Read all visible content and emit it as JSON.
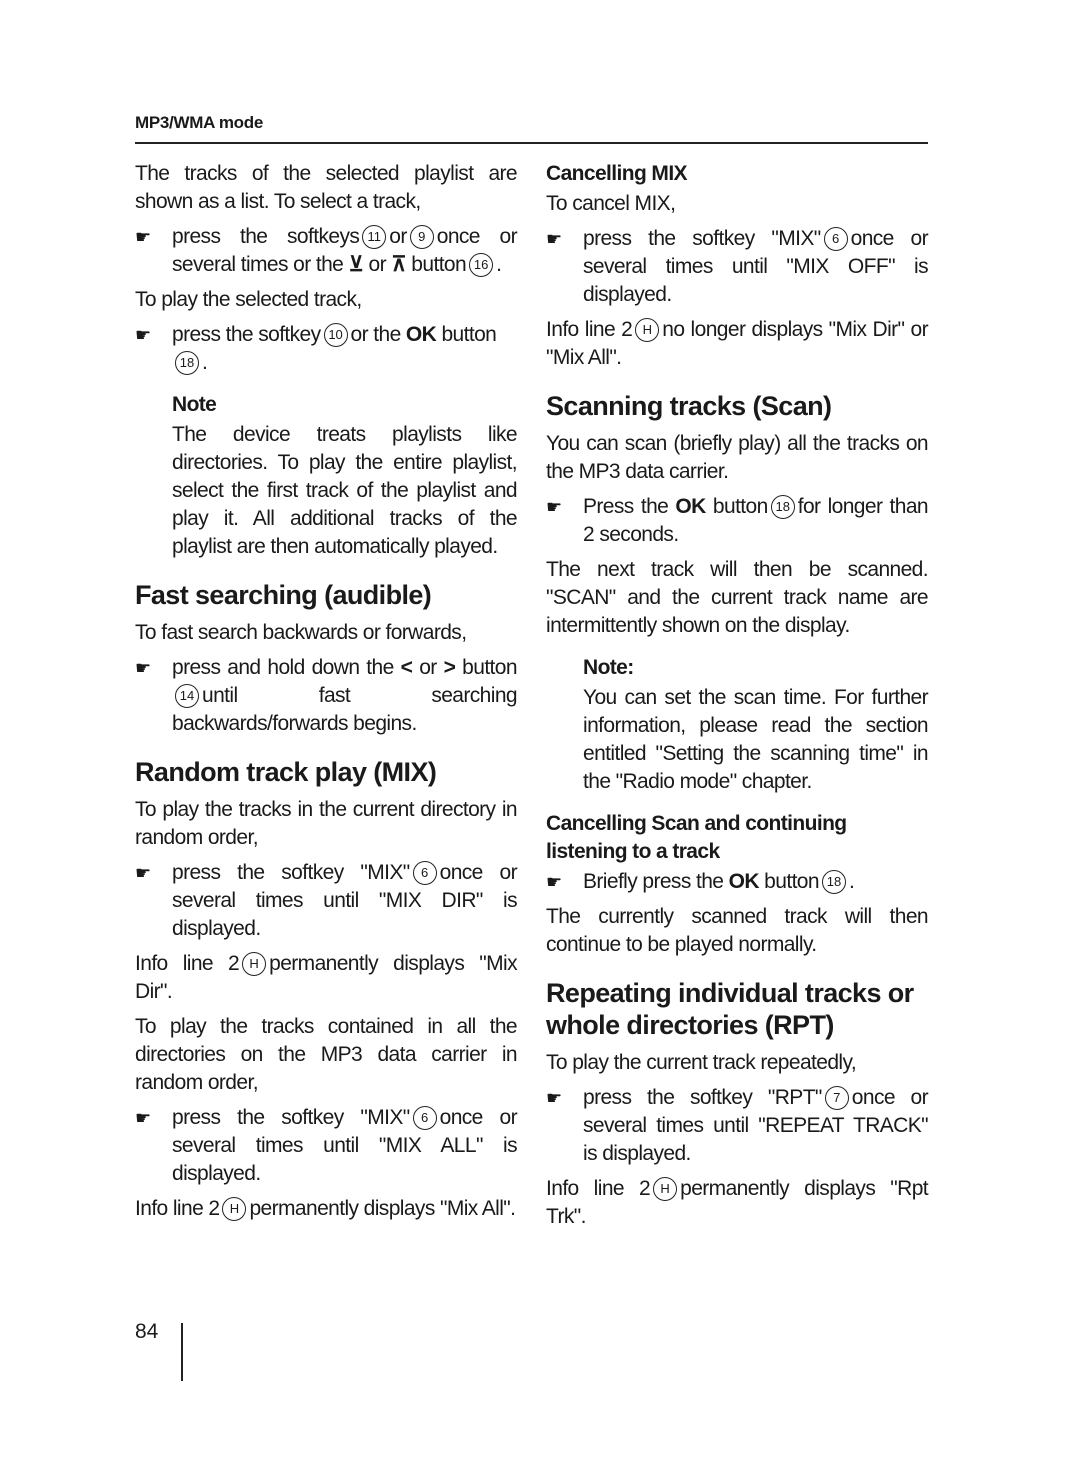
{
  "header": {
    "title": "MP3/WMA mode"
  },
  "left": {
    "intro": "The tracks of the selected playlist are shown as a list. To select a track,",
    "bullet1": {
      "a": "press the softkeys",
      "k1": "11",
      "b": "or",
      "k2": "9",
      "c": "once or several times or the",
      "sym1": "⊻",
      "d": "or",
      "sym2": "⊼",
      "e": "button",
      "k3": "16",
      "f": "."
    },
    "play_intro": "To play the selected track,",
    "bullet2": {
      "a": "press the softkey",
      "k1": "10",
      "b": "or the",
      "ok": "OK",
      "c": "button",
      "k2": "18",
      "d": "."
    },
    "note": {
      "title": "Note",
      "text": "The device treats playlists like directories. To play the entire playlist, select the first track of the playlist and play it. All additional tracks of the playlist are then automatically played."
    },
    "fast": {
      "heading": "Fast searching (audible)",
      "intro": "To fast search backwards or forwards,",
      "bullet": {
        "a": "press and hold down the",
        "sym1": "<",
        "b": "or",
        "sym2": ">",
        "c": "button",
        "k1": "14",
        "d": "until fast searching backwards/forwards begins."
      }
    },
    "mix": {
      "heading": "Random track play (MIX)",
      "intro1": "To play the tracks in the current directory in random order,",
      "bullet1": {
        "a": "press the softkey \"MIX\"",
        "k1": "6",
        "b": "once or several times until \"MIX DIR\" is displayed."
      },
      "info1": {
        "a": "Info line 2",
        "k": "H",
        "b": "permanently displays \"Mix Dir\"."
      },
      "intro2": "To play the tracks contained in all the directories on the MP3 data carrier in random order,",
      "bullet2": {
        "a": "press the softkey \"MIX\"",
        "k1": "6",
        "b": "once or several times until \"MIX ALL\" is displayed."
      },
      "info2": {
        "a": "Info line 2",
        "k": "H",
        "b": "permanently displays \"Mix All\"."
      }
    }
  },
  "right": {
    "cancel_mix": {
      "heading": "Cancelling MIX",
      "intro": "To cancel MIX,",
      "bullet": {
        "a": "press the softkey \"MIX\"",
        "k1": "6",
        "b": "once or several times until \"MIX OFF\" is displayed."
      },
      "info": {
        "a": "Info line 2",
        "k": "H",
        "b": "no longer displays \"Mix Dir\" or \"Mix All\"."
      }
    },
    "scan": {
      "heading": "Scanning tracks (Scan)",
      "intro": "You can scan (briefly play) all the tracks on the MP3 data carrier.",
      "bullet": {
        "a": "Press the",
        "ok": "OK",
        "b": "button",
        "k1": "18",
        "c": "for longer than 2 seconds."
      },
      "result": "The next track will then be scanned. \"SCAN\" and the current track name are intermittently shown on the display.",
      "note": {
        "title": "Note:",
        "text": "You can set the scan time. For further information, please read the section entitled \"Setting the scanning time\" in the \"Radio mode\" chapter."
      }
    },
    "cancel_scan": {
      "heading": "Cancelling Scan and continuing listening to a track",
      "bullet": {
        "a": "Briefly press the",
        "ok": "OK",
        "b": "button",
        "k1": "18",
        "c": "."
      },
      "result": "The currently scanned track will then continue to be played normally."
    },
    "rpt": {
      "heading": "Repeating individual tracks or whole directories (RPT)",
      "intro": "To play the current track repeatedly,",
      "bullet": {
        "a": "press the softkey \"RPT\"",
        "k1": "7",
        "b": "once or several times until \"REPEAT TRACK\" is displayed."
      },
      "info": {
        "a": "Info line 2",
        "k": "H",
        "b": "permanently displays \"Rpt Trk\"."
      }
    }
  },
  "footer": {
    "page_number": "84"
  }
}
